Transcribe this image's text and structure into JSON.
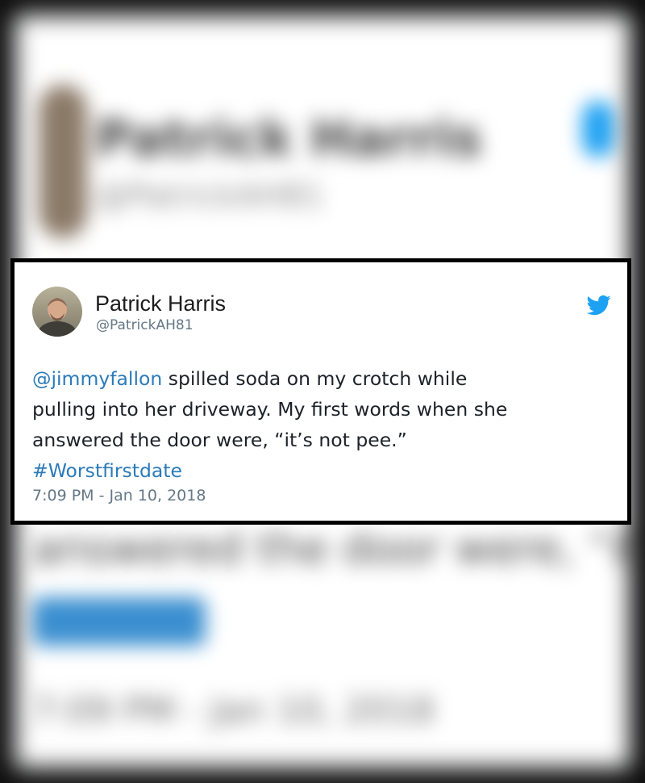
{
  "tweet": {
    "author": {
      "name": "Patrick Harris",
      "handle": "@PatrickAH81"
    },
    "mention": "@jimmyfallon",
    "line1_rest": " spilled soda on my crotch while",
    "line2": "pulling into her driveway.  My first words when she",
    "line3": "answered the door were, “it’s not pee.”",
    "hashtag": "#Worstfirstdate",
    "timestamp": "7:09 PM - Jan 10, 2018",
    "icon": "twitter-bird-icon"
  },
  "background_blurred": {
    "name": "Patrick Harris",
    "handle": "@PatrickAH81",
    "line": "answered the door were, “it’s not pee.”",
    "date": "7:09 PM - Jan 10, 2018"
  },
  "colors": {
    "link": "#2b7bb9",
    "twitter_blue": "#1da1f2",
    "text": "#1c2229",
    "muted": "#657786",
    "frame": "#000000"
  }
}
